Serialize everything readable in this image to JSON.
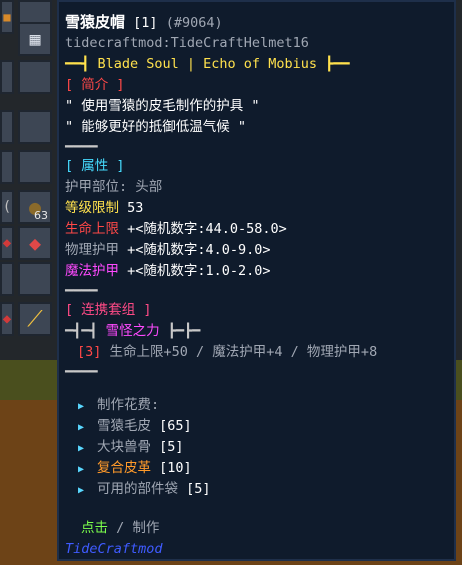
{
  "item": {
    "name": "雪猿皮帽",
    "stack": "[1]",
    "id": "(#9064)",
    "internal_name": "tidecraftmod:TideCraftHelmet16",
    "series_line": "━━┫ Blade Soul | Echo of Mobius ┣━━",
    "intro_header": "[ 简介 ]",
    "intro_lines": [
      "\" 使用雪猿的皮毛制作的护具 \"",
      "\" 能够更好的抵御低温气候 \""
    ],
    "sep1": "━━━━",
    "attr_header": "[ 属性 ]",
    "armor_slot": "护甲部位: 头部",
    "level_label": "等级限制",
    "level_value": "53",
    "stats": [
      {
        "label": "生命上限",
        "value": "+<随机数字:44.0-58.0>"
      },
      {
        "label": "物理护甲",
        "value": "+<随机数字:4.0-9.0>"
      },
      {
        "label": "魔法护甲",
        "value": "+<随机数字:1.0-2.0>"
      }
    ],
    "sep2": "━━━━",
    "set_header": "[ 连携套组 ]",
    "set_left_deco": "━┫━┫",
    "set_name": "雪怪之力",
    "set_right_deco": "┣━┣━",
    "set_bonus_count": "[3]",
    "set_bonus_text": "生命上限+50 / 魔法护甲+4 / 物理护甲+8",
    "sep3": "━━━━",
    "craft_header": "制作花费:",
    "craft_items": [
      {
        "name": "雪猿毛皮",
        "count": "[65]"
      },
      {
        "name": "大块兽骨",
        "count": "[5]"
      },
      {
        "name": "复合皮革",
        "count": "[10]"
      },
      {
        "name": "可用的部件袋",
        "count": "[5]"
      }
    ],
    "action_click": "点击",
    "action_sep": "/",
    "action_label": "制作",
    "mod_name": "TideCraftmod"
  },
  "inventory": {
    "slot_count_label": "63"
  },
  "colors": {
    "tooltip_bg": "#0f1b2c",
    "level": "#ffe14d",
    "hp": "#ff4848",
    "armor": "#ffffff",
    "magic": "#ff4aff",
    "crafted_highlight": "#ff9a2a"
  }
}
